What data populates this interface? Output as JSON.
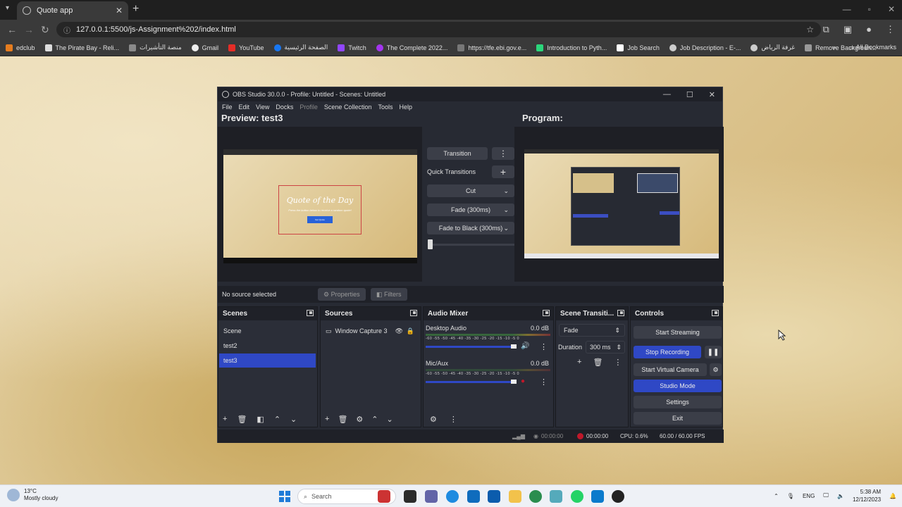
{
  "browser": {
    "tab_title": "Quote app",
    "url": "127.0.0.1:5500/js-Assignment%202/index.html",
    "bookmarks": [
      "edclub",
      "The Pirate Bay - Reli...",
      "منصة التأشيرات",
      "Gmail",
      "YouTube",
      "الصفحة الرئيسية",
      "Twitch",
      "The Complete 2022...",
      "https://tfe.ebi.gov.e...",
      "Introduction to Pyth...",
      "Job Search",
      "Job Description - E-...",
      "غرفة الرياض",
      "Remove Backgroun..."
    ],
    "all_bookmarks": "All Bookmarks"
  },
  "obs": {
    "window_title": "OBS Studio 30.0.0 - Profile: Untitled - Scenes: Untitled",
    "menu": [
      "File",
      "Edit",
      "View",
      "Docks",
      "Profile",
      "Scene Collection",
      "Tools",
      "Help"
    ],
    "preview_label": "Preview: test3",
    "program_label": "Program:",
    "preview_content": {
      "title": "Quote of the Day",
      "subtitle": "Press the button below to receive a random quote!",
      "button": "Get Quote"
    },
    "transition": {
      "transition_button": "Transition",
      "quick_transitions": "Quick Transitions",
      "cut": "Cut",
      "fade": "Fade (300ms)",
      "fade_black": "Fade to Black (300ms)"
    },
    "no_source": "No source selected",
    "properties": "Properties",
    "filters": "Filters",
    "scenes": {
      "title": "Scenes",
      "items": [
        "Scene",
        "test2",
        "test3"
      ]
    },
    "sources": {
      "title": "Sources",
      "items": [
        "Window Capture 3"
      ]
    },
    "audio": {
      "title": "Audio Mixer",
      "scale": "-60 -55 -50 -45 -40 -35 -30 -25 -20 -15 -10 -5 0",
      "channels": [
        {
          "name": "Desktop Audio",
          "db": "0.0 dB"
        },
        {
          "name": "Mic/Aux",
          "db": "0.0 dB"
        }
      ]
    },
    "scene_transitions": {
      "title": "Scene Transiti...",
      "selected": "Fade",
      "duration_label": "Duration",
      "duration_value": "300 ms"
    },
    "controls": {
      "title": "Controls",
      "start_streaming": "Start Streaming",
      "stop_recording": "Stop Recording",
      "start_virtual_camera": "Start Virtual Camera",
      "studio_mode": "Studio Mode",
      "settings": "Settings",
      "exit": "Exit"
    },
    "statusbar": {
      "stream_time": "00:00:00",
      "rec_time": "00:00:00",
      "cpu": "CPU: 0.6%",
      "fps": "60.00 / 60.00 FPS"
    }
  },
  "taskbar": {
    "weather_temp": "13°C",
    "weather_desc": "Mostly cloudy",
    "search": "Search",
    "lang": "ENG",
    "time": "5:38 AM",
    "date": "12/12/2023"
  }
}
